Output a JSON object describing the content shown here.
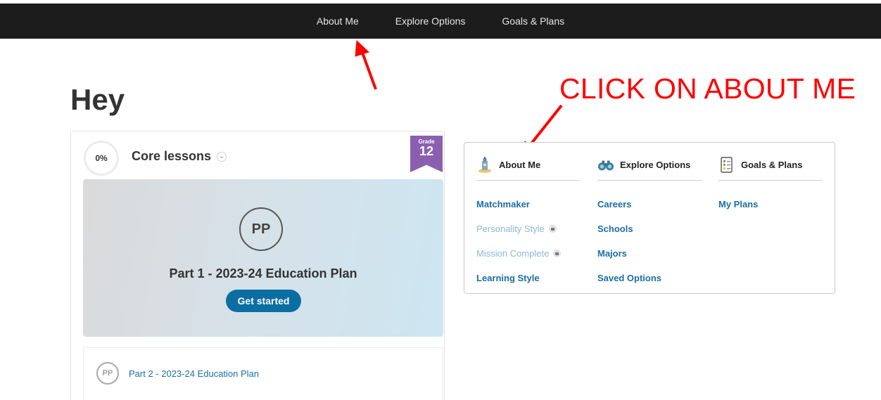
{
  "nav": {
    "items": [
      {
        "label": "About Me"
      },
      {
        "label": "Explore Options"
      },
      {
        "label": "Goals & Plans"
      }
    ]
  },
  "greeting": "Hey",
  "annotation": {
    "text": "CLICK ON ABOUT ME",
    "color": "#ff0000"
  },
  "core": {
    "progress": "0%",
    "title": "Core lessons",
    "grade_label": "Grade",
    "grade_number": "12",
    "hero": {
      "initials": "PP",
      "title": "Part 1 - 2023-24 Education Plan",
      "button_label": "Get started"
    },
    "next": {
      "initials": "PP",
      "title": "Part 2 - 2023-24 Education Plan"
    }
  },
  "menu": {
    "about": {
      "header": "About Me",
      "icon": "tower-icon",
      "items": [
        {
          "label": "Matchmaker",
          "locked": false
        },
        {
          "label": "Personality Style",
          "locked": true
        },
        {
          "label": "Mission Complete",
          "locked": true
        },
        {
          "label": "Learning Style",
          "locked": false
        }
      ]
    },
    "explore": {
      "header": "Explore Options",
      "icon": "binoculars-icon",
      "items": [
        {
          "label": "Careers"
        },
        {
          "label": "Schools"
        },
        {
          "label": "Majors"
        },
        {
          "label": "Saved Options"
        }
      ]
    },
    "goals": {
      "header": "Goals & Plans",
      "icon": "checklist-icon",
      "items": [
        {
          "label": "My Plans"
        }
      ]
    }
  },
  "colors": {
    "topbar": "#1c1c1c",
    "link": "#1b6ea3",
    "button": "#0b6ea3",
    "ribbon": "#8b5fb0"
  }
}
